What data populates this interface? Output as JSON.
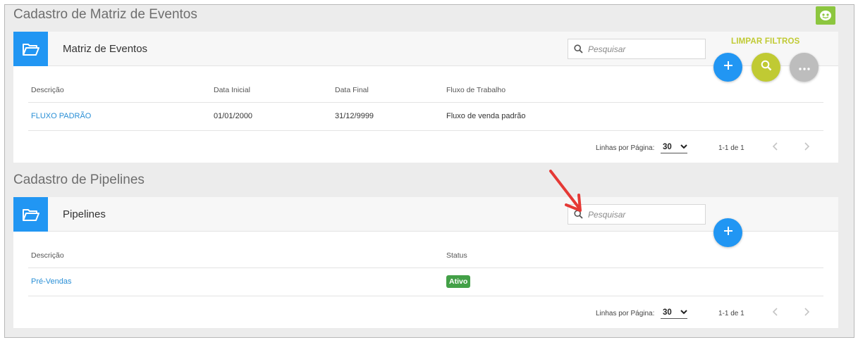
{
  "matriz": {
    "section_title": "Cadastro de Matriz de Eventos",
    "card_title": "Matriz de Eventos",
    "search_placeholder": "Pesquisar",
    "clear_filters": "LIMPAR FILTROS",
    "columns": [
      "Descrição",
      "Data Inicial",
      "Data Final",
      "Fluxo de Trabalho"
    ],
    "rows": [
      {
        "descricao": "FLUXO PADRÃO",
        "data_inicial": "01/01/2000",
        "data_final": "31/12/9999",
        "fluxo": "Fluxo de venda padrão"
      }
    ],
    "pager": {
      "label": "Linhas por Página:",
      "per_page": "30",
      "range": "1-1 de 1"
    }
  },
  "pipelines": {
    "section_title": "Cadastro de Pipelines",
    "card_title": "Pipelines",
    "search_placeholder": "Pesquisar",
    "columns": [
      "Descrição",
      "Status"
    ],
    "rows": [
      {
        "descricao": "Pré-Vendas",
        "status": "Ativo"
      }
    ],
    "pager": {
      "label": "Linhas por Página:",
      "per_page": "30",
      "range": "1-1 de 1"
    }
  },
  "icons": {
    "folder": "folder-open-icon",
    "search": "search-icon",
    "add": "plus-icon",
    "more": "more-horizontal-icon",
    "prev": "chevron-left-icon",
    "next": "chevron-right-icon",
    "help": "helper-face-icon"
  },
  "colors": {
    "primary": "#2196f3",
    "lime": "#c0ca33",
    "gray": "#bdbdbd",
    "status_active": "#43a047",
    "link": "#2a8fd6",
    "annotation_arrow": "#e53935"
  }
}
